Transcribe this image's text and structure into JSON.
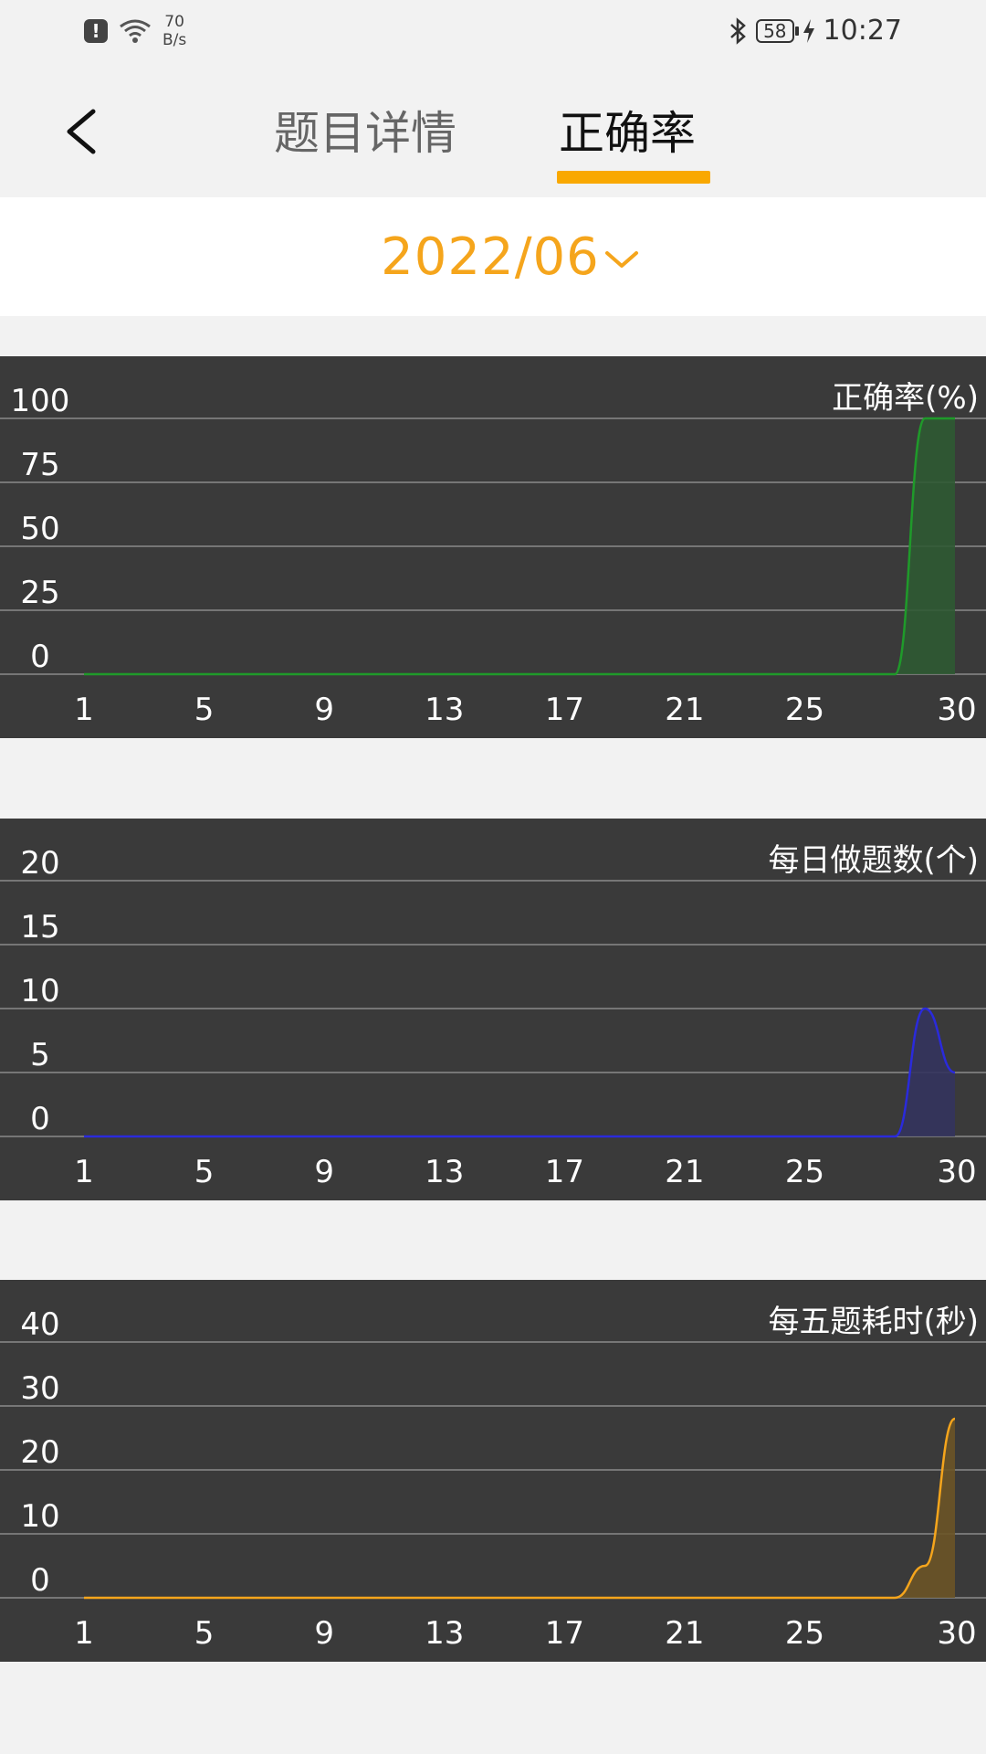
{
  "status": {
    "net_speed_value": "70",
    "net_speed_unit": "B/s",
    "battery": "58",
    "time": "10:27"
  },
  "header": {
    "tabs": [
      {
        "label": "题目详情",
        "active": false
      },
      {
        "label": "正确率",
        "active": true
      }
    ]
  },
  "month_selector": {
    "value": "2022/06"
  },
  "colors": {
    "accent": "#f9a800",
    "chart_bg": "#3a3a3a"
  },
  "chart_data": [
    {
      "type": "area",
      "title": "正确率(%)",
      "x": [
        1,
        2,
        3,
        4,
        5,
        6,
        7,
        8,
        9,
        10,
        11,
        12,
        13,
        14,
        15,
        16,
        17,
        18,
        19,
        20,
        21,
        22,
        23,
        24,
        25,
        26,
        27,
        28,
        29,
        30
      ],
      "x_ticks": [
        1,
        5,
        9,
        13,
        17,
        21,
        25,
        30
      ],
      "y_ticks": [
        0,
        25,
        50,
        75,
        100
      ],
      "ylim": [
        0,
        100
      ],
      "series": [
        {
          "color": "#1f9a2a",
          "fill": "#2f5a33",
          "values": [
            0,
            0,
            0,
            0,
            0,
            0,
            0,
            0,
            0,
            0,
            0,
            0,
            0,
            0,
            0,
            0,
            0,
            0,
            0,
            0,
            0,
            0,
            0,
            0,
            0,
            0,
            0,
            0,
            100,
            100
          ]
        }
      ]
    },
    {
      "type": "area",
      "title": "每日做题数(个)",
      "x": [
        1,
        2,
        3,
        4,
        5,
        6,
        7,
        8,
        9,
        10,
        11,
        12,
        13,
        14,
        15,
        16,
        17,
        18,
        19,
        20,
        21,
        22,
        23,
        24,
        25,
        26,
        27,
        28,
        29,
        30
      ],
      "x_ticks": [
        1,
        5,
        9,
        13,
        17,
        21,
        25,
        30
      ],
      "y_ticks": [
        0,
        5,
        10,
        15,
        20
      ],
      "ylim": [
        0,
        20
      ],
      "series": [
        {
          "color": "#2a2adc",
          "fill": "#34345e",
          "values": [
            0,
            0,
            0,
            0,
            0,
            0,
            0,
            0,
            0,
            0,
            0,
            0,
            0,
            0,
            0,
            0,
            0,
            0,
            0,
            0,
            0,
            0,
            0,
            0,
            0,
            0,
            0,
            0,
            10,
            5
          ]
        }
      ]
    },
    {
      "type": "area",
      "title": "每五题耗时(秒)",
      "x": [
        1,
        2,
        3,
        4,
        5,
        6,
        7,
        8,
        9,
        10,
        11,
        12,
        13,
        14,
        15,
        16,
        17,
        18,
        19,
        20,
        21,
        22,
        23,
        24,
        25,
        26,
        27,
        28,
        29,
        30
      ],
      "x_ticks": [
        1,
        5,
        9,
        13,
        17,
        21,
        25,
        30
      ],
      "y_ticks": [
        0,
        10,
        20,
        30,
        40
      ],
      "ylim": [
        0,
        40
      ],
      "series": [
        {
          "color": "#f5a51c",
          "fill": "#6b5427",
          "values": [
            0,
            0,
            0,
            0,
            0,
            0,
            0,
            0,
            0,
            0,
            0,
            0,
            0,
            0,
            0,
            0,
            0,
            0,
            0,
            0,
            0,
            0,
            0,
            0,
            0,
            0,
            0,
            0,
            5,
            28
          ]
        }
      ]
    }
  ]
}
